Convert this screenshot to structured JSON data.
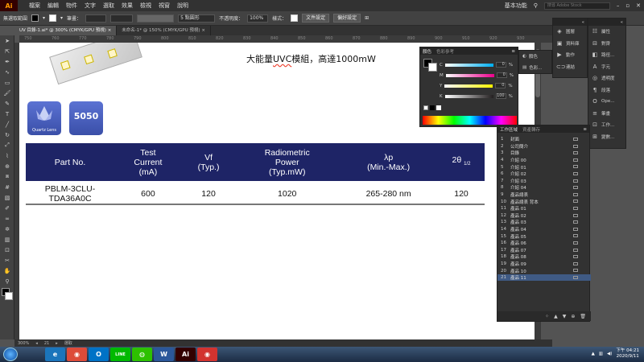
{
  "menubar": {
    "logo": "Ai",
    "items": [
      "檔案",
      "編輯",
      "物件",
      "文字",
      "選取",
      "效果",
      "檢視",
      "視窗",
      "說明"
    ],
    "workspace": "基本功能",
    "search_placeholder": "搜尋 Adobe Stock"
  },
  "control_bar": {
    "selection_label": "無選取範圍",
    "stroke_label": "筆畫：",
    "brush_value": "5 點圓形",
    "opacity_label": "不透明度：",
    "opacity_value": "100%",
    "style_label": "樣式：",
    "doc_setup_button": "文件設定",
    "prefs_button": "偏好設定"
  },
  "tabs": [
    {
      "label": "UV 目錄-1.ai* @ 300% (CMYK/GPU 預視)",
      "close": "×",
      "active": true
    },
    {
      "label": "未命名-1* @ 150% (CMYK/GPU 預視)",
      "close": "×",
      "active": false
    }
  ],
  "ruler_ticks": [
    "750",
    "760",
    "770",
    "780",
    "790",
    "800",
    "810",
    "820",
    "830",
    "840",
    "850",
    "860",
    "870",
    "880",
    "890",
    "900",
    "910",
    "920",
    "930"
  ],
  "toolbar_icons": [
    "selection-tool-icon",
    "direct-selection-tool-icon",
    "pen-tool-icon",
    "curvature-tool-icon",
    "rectangle-tool-icon",
    "paintbrush-tool-icon",
    "pencil-tool-icon",
    "type-tool-icon",
    "line-tool-icon",
    "rotate-tool-icon",
    "scale-tool-icon",
    "width-tool-icon",
    "shape-builder-icon",
    "perspective-grid-icon",
    "mesh-tool-icon",
    "gradient-tool-icon",
    "eyedropper-tool-icon",
    "blend-tool-icon",
    "symbol-sprayer-icon",
    "column-graph-icon",
    "artboard-tool-icon",
    "slice-tool-icon",
    "hand-tool-icon",
    "zoom-tool-icon"
  ],
  "document": {
    "title_prefix": "大能量",
    "title_underlined": "UVC",
    "title_suffix": "模組，高達1000mW",
    "quartz_lens_label": "Quartz Lens",
    "package_badge": "5050",
    "table_headers": [
      "Part No.",
      "Test\nCurrent\n(mA)",
      "Vf\n(Typ.)",
      "Radiometric\nPower\n(Typ.mW)",
      "λp\n(Min.-Max.)",
      "2θ"
    ],
    "table_header_sub": "1/2",
    "table_row": [
      "PBLM-3CLU-TDA36A0C",
      "600",
      "120",
      "1020",
      "265-280 nm",
      "120"
    ]
  },
  "color_panel": {
    "tab_color": "顏色",
    "tab_guide": "色彩參考",
    "channels": [
      {
        "label": "C",
        "value": "0",
        "unit": "%",
        "color": "#00aeef"
      },
      {
        "label": "M",
        "value": "0",
        "unit": "%",
        "color": "#ec008c"
      },
      {
        "label": "Y",
        "value": "0",
        "unit": "%",
        "color": "#fff200"
      },
      {
        "label": "K",
        "value": "100",
        "unit": "%",
        "color": "#231f20"
      }
    ]
  },
  "mini_panel": {
    "item1": "顏色",
    "item2": "色彩..."
  },
  "side_panel_1": [
    "圖層",
    "資料庫",
    "動作",
    "連結"
  ],
  "side_panel_2": [
    "屬性",
    "對齊",
    "路徑...",
    "字元",
    "透明度",
    "段落",
    "Ope...",
    "筆畫",
    "工作...",
    "變數..."
  ],
  "pages_panel": {
    "tab_active": "工作區域",
    "tab_other": "資產轉存",
    "rows": [
      {
        "num": "1",
        "name": "封面"
      },
      {
        "num": "2",
        "name": "公司簡介"
      },
      {
        "num": "3",
        "name": "目錄"
      },
      {
        "num": "4",
        "name": "介紹 00"
      },
      {
        "num": "5",
        "name": "介紹 01"
      },
      {
        "num": "6",
        "name": "介紹 02"
      },
      {
        "num": "7",
        "name": "介紹 03"
      },
      {
        "num": "8",
        "name": "介紹 04"
      },
      {
        "num": "9",
        "name": "產品總表"
      },
      {
        "num": "10",
        "name": "產品總表 背本"
      },
      {
        "num": "11",
        "name": "產品 01"
      },
      {
        "num": "12",
        "name": "產品 02"
      },
      {
        "num": "13",
        "name": "產品 03"
      },
      {
        "num": "14",
        "name": "產品 04"
      },
      {
        "num": "15",
        "name": "產品 05"
      },
      {
        "num": "16",
        "name": "產品 06"
      },
      {
        "num": "17",
        "name": "產品 07"
      },
      {
        "num": "18",
        "name": "產品 08"
      },
      {
        "num": "19",
        "name": "產品 09"
      },
      {
        "num": "20",
        "name": "產品 10"
      },
      {
        "num": "21",
        "name": "產品 11"
      }
    ],
    "selected_index": 20
  },
  "status_bar": {
    "zoom": "300%",
    "page": "21",
    "mode": "選取"
  },
  "taskbar": {
    "apps": [
      {
        "name": "ie-icon",
        "label": "e",
        "color": "#1b75bb"
      },
      {
        "name": "chrome-icon",
        "label": "◉",
        "color": "#dd4b39"
      },
      {
        "name": "outlook-icon",
        "label": "O",
        "color": "#0072c6"
      },
      {
        "name": "line-icon",
        "label": "LINE",
        "color": "#00b900"
      },
      {
        "name": "wechat-icon",
        "label": "◍",
        "color": "#2dc100"
      },
      {
        "name": "word-icon",
        "label": "W",
        "color": "#2b579a"
      },
      {
        "name": "illustrator-icon",
        "label": "Ai",
        "color": "#330000"
      },
      {
        "name": "chrome2-icon",
        "label": "◉",
        "color": "#d2332f"
      }
    ],
    "time": "下午 04:21",
    "date": "2020/9/11"
  }
}
